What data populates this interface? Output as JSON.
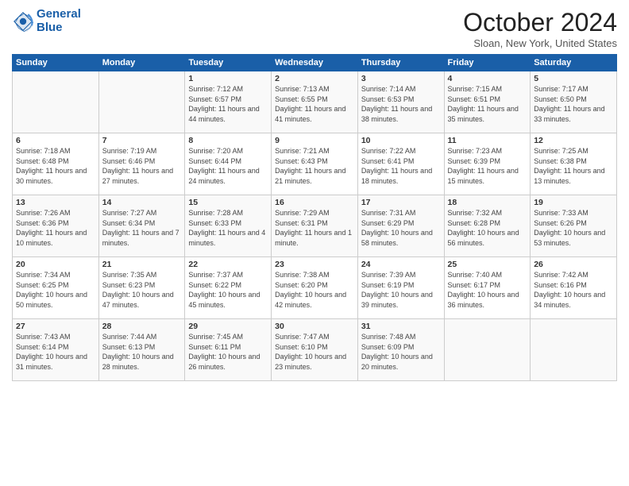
{
  "header": {
    "logo_line1": "General",
    "logo_line2": "Blue",
    "title": "October 2024",
    "location": "Sloan, New York, United States"
  },
  "weekdays": [
    "Sunday",
    "Monday",
    "Tuesday",
    "Wednesday",
    "Thursday",
    "Friday",
    "Saturday"
  ],
  "weeks": [
    [
      {
        "day": "",
        "content": ""
      },
      {
        "day": "",
        "content": ""
      },
      {
        "day": "1",
        "content": "Sunrise: 7:12 AM\nSunset: 6:57 PM\nDaylight: 11 hours\nand 44 minutes."
      },
      {
        "day": "2",
        "content": "Sunrise: 7:13 AM\nSunset: 6:55 PM\nDaylight: 11 hours\nand 41 minutes."
      },
      {
        "day": "3",
        "content": "Sunrise: 7:14 AM\nSunset: 6:53 PM\nDaylight: 11 hours\nand 38 minutes."
      },
      {
        "day": "4",
        "content": "Sunrise: 7:15 AM\nSunset: 6:51 PM\nDaylight: 11 hours\nand 35 minutes."
      },
      {
        "day": "5",
        "content": "Sunrise: 7:17 AM\nSunset: 6:50 PM\nDaylight: 11 hours\nand 33 minutes."
      }
    ],
    [
      {
        "day": "6",
        "content": "Sunrise: 7:18 AM\nSunset: 6:48 PM\nDaylight: 11 hours\nand 30 minutes."
      },
      {
        "day": "7",
        "content": "Sunrise: 7:19 AM\nSunset: 6:46 PM\nDaylight: 11 hours\nand 27 minutes."
      },
      {
        "day": "8",
        "content": "Sunrise: 7:20 AM\nSunset: 6:44 PM\nDaylight: 11 hours\nand 24 minutes."
      },
      {
        "day": "9",
        "content": "Sunrise: 7:21 AM\nSunset: 6:43 PM\nDaylight: 11 hours\nand 21 minutes."
      },
      {
        "day": "10",
        "content": "Sunrise: 7:22 AM\nSunset: 6:41 PM\nDaylight: 11 hours\nand 18 minutes."
      },
      {
        "day": "11",
        "content": "Sunrise: 7:23 AM\nSunset: 6:39 PM\nDaylight: 11 hours\nand 15 minutes."
      },
      {
        "day": "12",
        "content": "Sunrise: 7:25 AM\nSunset: 6:38 PM\nDaylight: 11 hours\nand 13 minutes."
      }
    ],
    [
      {
        "day": "13",
        "content": "Sunrise: 7:26 AM\nSunset: 6:36 PM\nDaylight: 11 hours\nand 10 minutes."
      },
      {
        "day": "14",
        "content": "Sunrise: 7:27 AM\nSunset: 6:34 PM\nDaylight: 11 hours\nand 7 minutes."
      },
      {
        "day": "15",
        "content": "Sunrise: 7:28 AM\nSunset: 6:33 PM\nDaylight: 11 hours\nand 4 minutes."
      },
      {
        "day": "16",
        "content": "Sunrise: 7:29 AM\nSunset: 6:31 PM\nDaylight: 11 hours\nand 1 minute."
      },
      {
        "day": "17",
        "content": "Sunrise: 7:31 AM\nSunset: 6:29 PM\nDaylight: 10 hours\nand 58 minutes."
      },
      {
        "day": "18",
        "content": "Sunrise: 7:32 AM\nSunset: 6:28 PM\nDaylight: 10 hours\nand 56 minutes."
      },
      {
        "day": "19",
        "content": "Sunrise: 7:33 AM\nSunset: 6:26 PM\nDaylight: 10 hours\nand 53 minutes."
      }
    ],
    [
      {
        "day": "20",
        "content": "Sunrise: 7:34 AM\nSunset: 6:25 PM\nDaylight: 10 hours\nand 50 minutes."
      },
      {
        "day": "21",
        "content": "Sunrise: 7:35 AM\nSunset: 6:23 PM\nDaylight: 10 hours\nand 47 minutes."
      },
      {
        "day": "22",
        "content": "Sunrise: 7:37 AM\nSunset: 6:22 PM\nDaylight: 10 hours\nand 45 minutes."
      },
      {
        "day": "23",
        "content": "Sunrise: 7:38 AM\nSunset: 6:20 PM\nDaylight: 10 hours\nand 42 minutes."
      },
      {
        "day": "24",
        "content": "Sunrise: 7:39 AM\nSunset: 6:19 PM\nDaylight: 10 hours\nand 39 minutes."
      },
      {
        "day": "25",
        "content": "Sunrise: 7:40 AM\nSunset: 6:17 PM\nDaylight: 10 hours\nand 36 minutes."
      },
      {
        "day": "26",
        "content": "Sunrise: 7:42 AM\nSunset: 6:16 PM\nDaylight: 10 hours\nand 34 minutes."
      }
    ],
    [
      {
        "day": "27",
        "content": "Sunrise: 7:43 AM\nSunset: 6:14 PM\nDaylight: 10 hours\nand 31 minutes."
      },
      {
        "day": "28",
        "content": "Sunrise: 7:44 AM\nSunset: 6:13 PM\nDaylight: 10 hours\nand 28 minutes."
      },
      {
        "day": "29",
        "content": "Sunrise: 7:45 AM\nSunset: 6:11 PM\nDaylight: 10 hours\nand 26 minutes."
      },
      {
        "day": "30",
        "content": "Sunrise: 7:47 AM\nSunset: 6:10 PM\nDaylight: 10 hours\nand 23 minutes."
      },
      {
        "day": "31",
        "content": "Sunrise: 7:48 AM\nSunset: 6:09 PM\nDaylight: 10 hours\nand 20 minutes."
      },
      {
        "day": "",
        "content": ""
      },
      {
        "day": "",
        "content": ""
      }
    ]
  ]
}
